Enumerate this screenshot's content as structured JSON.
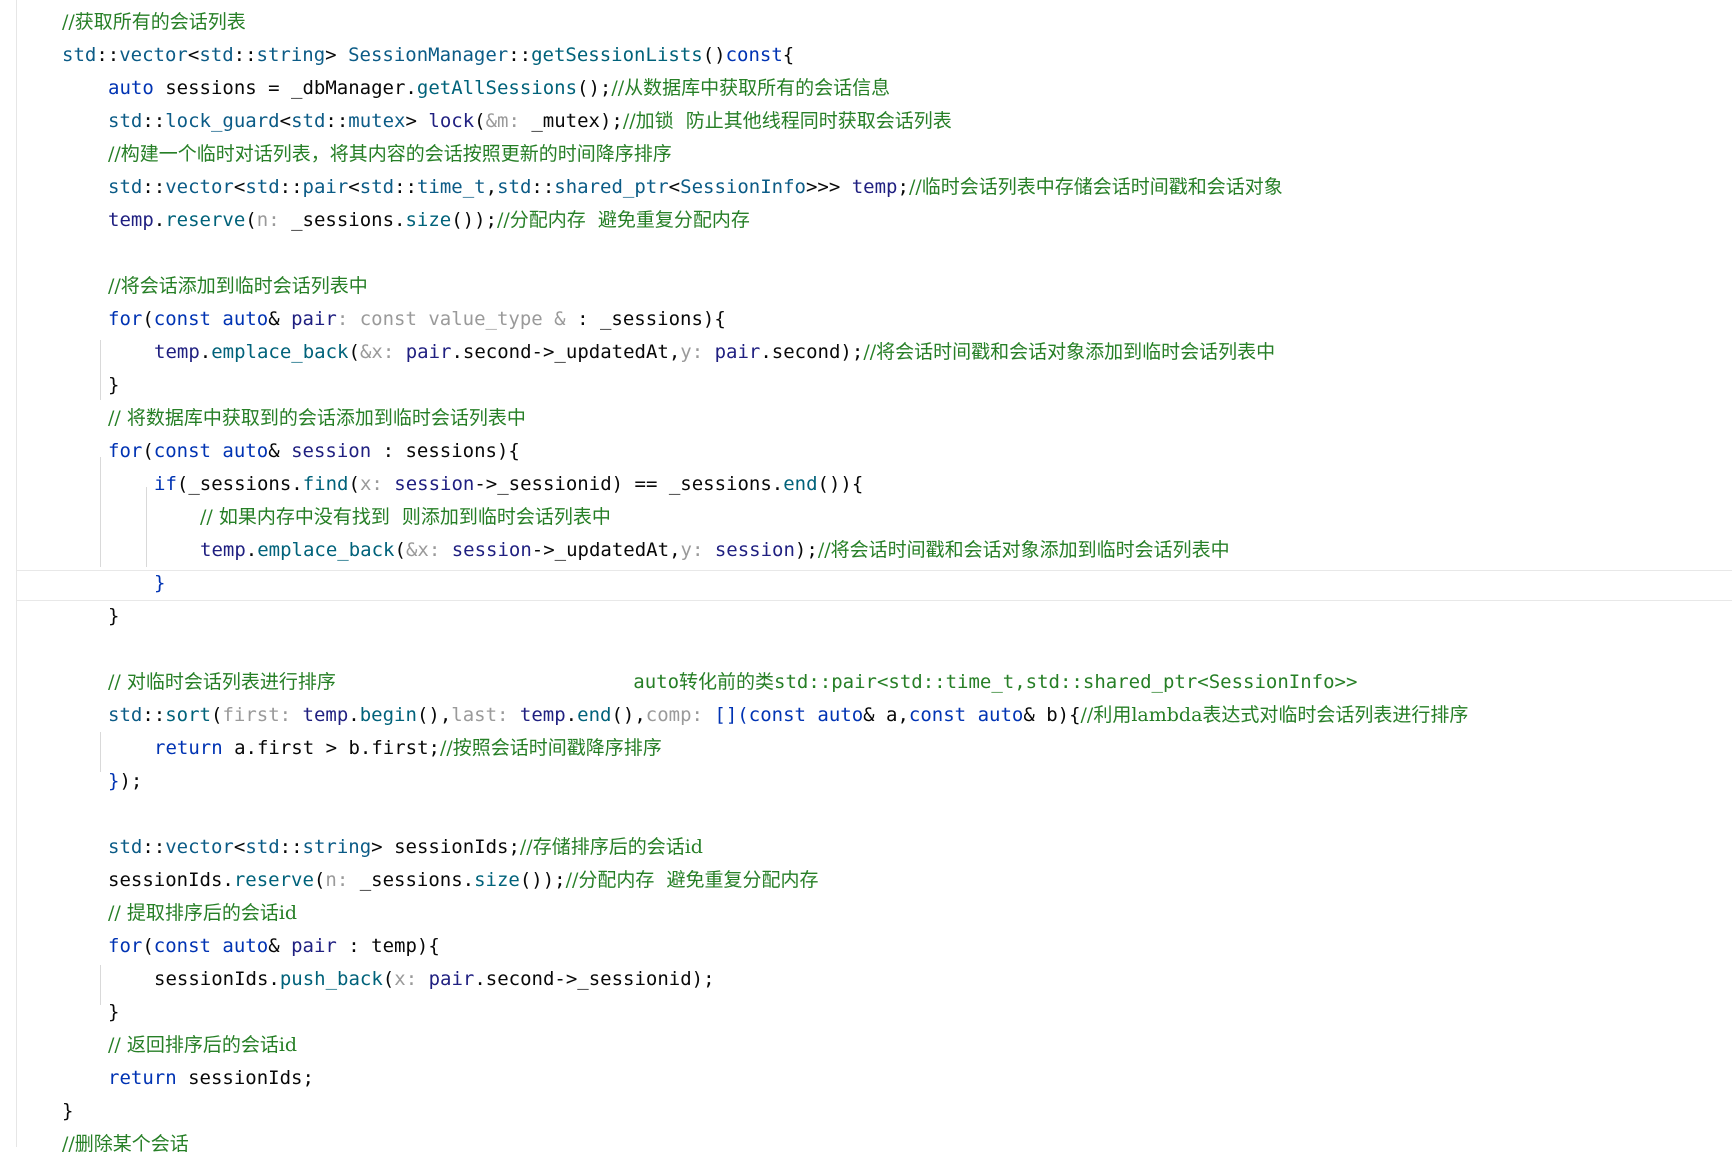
{
  "lines": [
    {
      "segments": [
        {
          "t": "//获取所有的会话列表",
          "c": "cm"
        }
      ]
    },
    {
      "segments": [
        {
          "t": "std",
          "c": "ns"
        },
        {
          "t": "::",
          "c": "pl"
        },
        {
          "t": "vector",
          "c": "ty"
        },
        {
          "t": "<",
          "c": "pl"
        },
        {
          "t": "std",
          "c": "ns"
        },
        {
          "t": "::",
          "c": "pl"
        },
        {
          "t": "string",
          "c": "ty"
        },
        {
          "t": "> ",
          "c": "pl"
        },
        {
          "t": "SessionManager",
          "c": "ty"
        },
        {
          "t": "::",
          "c": "pl"
        },
        {
          "t": "getSessionLists",
          "c": "fn"
        },
        {
          "t": "()",
          "c": "pl"
        },
        {
          "t": "const",
          "c": "kw"
        },
        {
          "t": "{",
          "c": "pl"
        }
      ]
    },
    {
      "segments": [
        {
          "t": "auto",
          "c": "kw"
        },
        {
          "t": " sessions = _dbManager.",
          "c": "pl"
        },
        {
          "t": "getAllSessions",
          "c": "fn"
        },
        {
          "t": "();",
          "c": "pl"
        },
        {
          "t": "//从数据库中获取所有的会话信息",
          "c": "cm"
        }
      ]
    },
    {
      "segments": [
        {
          "t": "std",
          "c": "ns"
        },
        {
          "t": "::",
          "c": "pl"
        },
        {
          "t": "lock_guard",
          "c": "ty"
        },
        {
          "t": "<",
          "c": "pl"
        },
        {
          "t": "std",
          "c": "ns"
        },
        {
          "t": "::",
          "c": "pl"
        },
        {
          "t": "mutex",
          "c": "ty"
        },
        {
          "t": "> ",
          "c": "pl"
        },
        {
          "t": "lock",
          "c": "var"
        },
        {
          "t": "(",
          "c": "pl"
        },
        {
          "t": "&m: ",
          "c": "hint"
        },
        {
          "t": "_mutex);",
          "c": "pl"
        },
        {
          "t": "//加锁  防止其他线程同时获取会话列表",
          "c": "cm"
        }
      ]
    },
    {
      "segments": [
        {
          "t": "//构建一个临时对话列表，将其内容的会话按照更新的时间降序排序",
          "c": "cm"
        }
      ]
    },
    {
      "segments": [
        {
          "t": "std",
          "c": "ns"
        },
        {
          "t": "::",
          "c": "pl"
        },
        {
          "t": "vector",
          "c": "ty"
        },
        {
          "t": "<",
          "c": "pl"
        },
        {
          "t": "std",
          "c": "ns"
        },
        {
          "t": "::",
          "c": "pl"
        },
        {
          "t": "pair",
          "c": "ty"
        },
        {
          "t": "<",
          "c": "pl"
        },
        {
          "t": "std",
          "c": "ns"
        },
        {
          "t": "::",
          "c": "pl"
        },
        {
          "t": "time_t",
          "c": "ty"
        },
        {
          "t": ",",
          "c": "pl"
        },
        {
          "t": "std",
          "c": "ns"
        },
        {
          "t": "::",
          "c": "pl"
        },
        {
          "t": "shared_ptr",
          "c": "ty"
        },
        {
          "t": "<",
          "c": "pl"
        },
        {
          "t": "SessionInfo",
          "c": "ty"
        },
        {
          "t": ">>> ",
          "c": "pl"
        },
        {
          "t": "temp",
          "c": "var"
        },
        {
          "t": ";",
          "c": "pl"
        },
        {
          "t": "//临时会话列表中存储会话时间戳和会话对象",
          "c": "cm"
        }
      ]
    },
    {
      "segments": [
        {
          "t": "temp",
          "c": "var"
        },
        {
          "t": ".",
          "c": "pl"
        },
        {
          "t": "reserve",
          "c": "fn"
        },
        {
          "t": "(",
          "c": "pl"
        },
        {
          "t": "n: ",
          "c": "hint"
        },
        {
          "t": "_sessions.",
          "c": "pl"
        },
        {
          "t": "size",
          "c": "fn"
        },
        {
          "t": "());",
          "c": "pl"
        },
        {
          "t": "//分配内存  避免重复分配内存",
          "c": "cm"
        }
      ]
    },
    {
      "segments": []
    },
    {
      "segments": [
        {
          "t": "//将会话添加到临时会话列表中",
          "c": "cm"
        }
      ]
    },
    {
      "segments": [
        {
          "t": "for",
          "c": "kw"
        },
        {
          "t": "(",
          "c": "pl"
        },
        {
          "t": "const ",
          "c": "kw"
        },
        {
          "t": "auto",
          "c": "kw"
        },
        {
          "t": "& ",
          "c": "pl"
        },
        {
          "t": "pair",
          "c": "var"
        },
        {
          "t": ": const value_type & ",
          "c": "hint"
        },
        {
          "t": ": _sessions){",
          "c": "pl"
        }
      ]
    },
    {
      "segments": [
        {
          "t": "temp",
          "c": "var"
        },
        {
          "t": ".",
          "c": "pl"
        },
        {
          "t": "emplace_back",
          "c": "fn"
        },
        {
          "t": "(",
          "c": "pl"
        },
        {
          "t": "&x: ",
          "c": "hint"
        },
        {
          "t": "pair",
          "c": "var"
        },
        {
          "t": ".second->_updatedAt,",
          "c": "pl"
        },
        {
          "t": "y: ",
          "c": "hint"
        },
        {
          "t": "pair",
          "c": "var"
        },
        {
          "t": ".second);",
          "c": "pl"
        },
        {
          "t": "//将会话时间戳和会话对象添加到临时会话列表中",
          "c": "cm"
        }
      ]
    },
    {
      "segments": [
        {
          "t": "}",
          "c": "pl"
        }
      ]
    },
    {
      "segments": [
        {
          "t": "// 将数据库中获取到的会话添加到临时会话列表中",
          "c": "cm"
        }
      ]
    },
    {
      "segments": [
        {
          "t": "for",
          "c": "kw"
        },
        {
          "t": "(",
          "c": "pl"
        },
        {
          "t": "const ",
          "c": "kw"
        },
        {
          "t": "auto",
          "c": "kw"
        },
        {
          "t": "& ",
          "c": "pl"
        },
        {
          "t": "session",
          "c": "var"
        },
        {
          "t": " : sessions){",
          "c": "pl"
        }
      ]
    },
    {
      "segments": [
        {
          "t": "if",
          "c": "kw"
        },
        {
          "t": "(_sessions.",
          "c": "pl"
        },
        {
          "t": "find",
          "c": "fn"
        },
        {
          "t": "(",
          "c": "pl"
        },
        {
          "t": "x: ",
          "c": "hint"
        },
        {
          "t": "session",
          "c": "var"
        },
        {
          "t": "->_sessionid) == _sessions.",
          "c": "pl"
        },
        {
          "t": "end",
          "c": "fn"
        },
        {
          "t": "()){",
          "c": "pl"
        }
      ]
    },
    {
      "segments": [
        {
          "t": "// 如果内存中没有找到  则添加到临时会话列表中",
          "c": "cm"
        }
      ]
    },
    {
      "segments": [
        {
          "t": "temp",
          "c": "var"
        },
        {
          "t": ".",
          "c": "pl"
        },
        {
          "t": "emplace_back",
          "c": "fn"
        },
        {
          "t": "(",
          "c": "pl"
        },
        {
          "t": "&x: ",
          "c": "hint"
        },
        {
          "t": "session",
          "c": "var"
        },
        {
          "t": "->_updatedAt,",
          "c": "pl"
        },
        {
          "t": "y: ",
          "c": "hint"
        },
        {
          "t": "session",
          "c": "var"
        },
        {
          "t": ");",
          "c": "pl"
        },
        {
          "t": "//将会话时间戳和会话对象添加到临时会话列表中",
          "c": "cm"
        }
      ]
    },
    {
      "segments": [
        {
          "t": "}",
          "c": "kw"
        }
      ]
    },
    {
      "segments": [
        {
          "t": "}",
          "c": "pl"
        }
      ]
    },
    {
      "segments": []
    },
    {
      "segments": [
        {
          "t": "// 对临时会话列表进行排序",
          "c": "cm"
        },
        {
          "t": "                          ",
          "c": "pl"
        },
        {
          "t": "auto转化前的类std::pair<std::time_t,std::shared_ptr<SessionInfo>>",
          "c": "cmm"
        }
      ]
    },
    {
      "segments": [
        {
          "t": "std",
          "c": "ns"
        },
        {
          "t": "::",
          "c": "pl"
        },
        {
          "t": "sort",
          "c": "fn"
        },
        {
          "t": "(",
          "c": "pl"
        },
        {
          "t": "first: ",
          "c": "hint"
        },
        {
          "t": "temp",
          "c": "var"
        },
        {
          "t": ".",
          "c": "pl"
        },
        {
          "t": "begin",
          "c": "fn"
        },
        {
          "t": "(),",
          "c": "pl"
        },
        {
          "t": "last: ",
          "c": "hint"
        },
        {
          "t": "temp",
          "c": "var"
        },
        {
          "t": ".",
          "c": "pl"
        },
        {
          "t": "end",
          "c": "fn"
        },
        {
          "t": "(),",
          "c": "pl"
        },
        {
          "t": "comp: ",
          "c": "hint"
        },
        {
          "t": "[](",
          "c": "kw"
        },
        {
          "t": "const ",
          "c": "kw"
        },
        {
          "t": "auto",
          "c": "kw"
        },
        {
          "t": "& a,",
          "c": "pl"
        },
        {
          "t": "const ",
          "c": "kw"
        },
        {
          "t": "auto",
          "c": "kw"
        },
        {
          "t": "& b){",
          "c": "pl"
        },
        {
          "t": "//利用lambda表达式对临时会话列表进行排序",
          "c": "cm"
        }
      ]
    },
    {
      "segments": [
        {
          "t": "return",
          "c": "kw"
        },
        {
          "t": " a.first > b.first;",
          "c": "pl"
        },
        {
          "t": "//按照会话时间戳降序排序",
          "c": "cm"
        }
      ]
    },
    {
      "segments": [
        {
          "t": "}",
          "c": "kw"
        },
        {
          "t": ");",
          "c": "pl"
        }
      ]
    },
    {
      "segments": []
    },
    {
      "segments": [
        {
          "t": "std",
          "c": "ns"
        },
        {
          "t": "::",
          "c": "pl"
        },
        {
          "t": "vector",
          "c": "ty"
        },
        {
          "t": "<",
          "c": "pl"
        },
        {
          "t": "std",
          "c": "ns"
        },
        {
          "t": "::",
          "c": "pl"
        },
        {
          "t": "string",
          "c": "ty"
        },
        {
          "t": "> ",
          "c": "pl"
        },
        {
          "t": "sessionIds;",
          "c": "pl"
        },
        {
          "t": "//存储排序后的会话id",
          "c": "cm"
        }
      ]
    },
    {
      "segments": [
        {
          "t": "sessionIds.",
          "c": "pl"
        },
        {
          "t": "reserve",
          "c": "fn"
        },
        {
          "t": "(",
          "c": "pl"
        },
        {
          "t": "n: ",
          "c": "hint"
        },
        {
          "t": "_sessions.",
          "c": "pl"
        },
        {
          "t": "size",
          "c": "fn"
        },
        {
          "t": "());",
          "c": "pl"
        },
        {
          "t": "//分配内存  避免重复分配内存",
          "c": "cm"
        }
      ]
    },
    {
      "segments": [
        {
          "t": "// 提取排序后的会话id",
          "c": "cm"
        }
      ]
    },
    {
      "segments": [
        {
          "t": "for",
          "c": "kw"
        },
        {
          "t": "(",
          "c": "pl"
        },
        {
          "t": "const ",
          "c": "kw"
        },
        {
          "t": "auto",
          "c": "kw"
        },
        {
          "t": "& ",
          "c": "pl"
        },
        {
          "t": "pair",
          "c": "var"
        },
        {
          "t": " : temp){",
          "c": "pl"
        }
      ]
    },
    {
      "segments": [
        {
          "t": "sessionIds.",
          "c": "pl"
        },
        {
          "t": "push_back",
          "c": "fn"
        },
        {
          "t": "(",
          "c": "pl"
        },
        {
          "t": "x: ",
          "c": "hint"
        },
        {
          "t": "pair",
          "c": "var"
        },
        {
          "t": ".second->_sessionid);",
          "c": "pl"
        }
      ]
    },
    {
      "segments": [
        {
          "t": "}",
          "c": "pl"
        }
      ]
    },
    {
      "segments": [
        {
          "t": "// 返回排序后的会话id",
          "c": "cm"
        }
      ]
    },
    {
      "segments": [
        {
          "t": "return",
          "c": "kw"
        },
        {
          "t": " sessionIds;",
          "c": "pl"
        }
      ]
    },
    {
      "segments": [
        {
          "t": "}",
          "c": "pl"
        }
      ]
    },
    {
      "segments": [
        {
          "t": "//删除某个会话",
          "c": "cm"
        }
      ]
    }
  ]
}
